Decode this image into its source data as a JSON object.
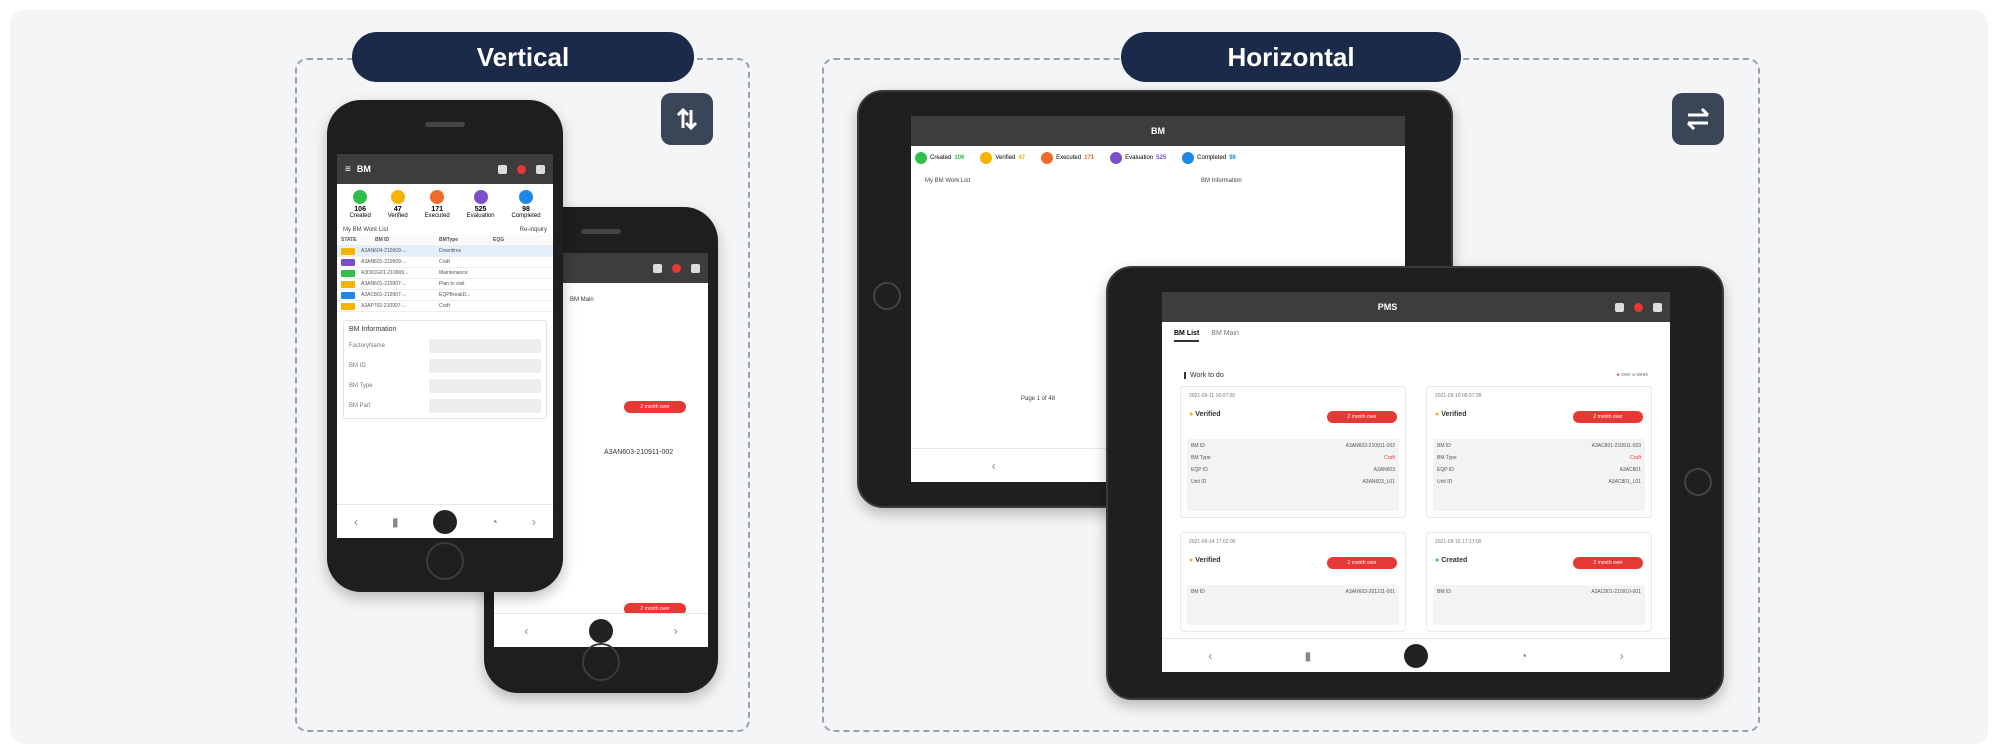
{
  "headings": {
    "vertical": "Vertical",
    "horizontal": "Horizontal"
  },
  "icons": {
    "vertical_toggle": "swap-vertical-icon",
    "horizontal_toggle": "swap-horizontal-icon"
  },
  "colors": {
    "pill_bg": "#1b2a49",
    "created": "#2fbf4a",
    "verified": "#f5b400",
    "executed": "#f06a2b",
    "evaluation": "#7b4fc9",
    "completed": "#1e88e5",
    "alert": "#e53935"
  },
  "phone_front": {
    "app_title": "BM",
    "stats": [
      {
        "value": "106",
        "label": "Created"
      },
      {
        "value": "47",
        "label": "Verified"
      },
      {
        "value": "171",
        "label": "Executed"
      },
      {
        "value": "525",
        "label": "Evaluation"
      },
      {
        "value": "98",
        "label": "Completed"
      }
    ],
    "list_title": "My BM Work List",
    "inquiry": "Re-inquiry",
    "columns": [
      "STATE",
      "BM ID",
      "BMType",
      "EQG"
    ],
    "rows": [
      {
        "id": "A3AN604-210909-...",
        "type": "Downtime"
      },
      {
        "id": "A3AN601-210909-...",
        "type": "Craft"
      },
      {
        "id": "A3D01G01-210909...",
        "type": "Maintenance"
      },
      {
        "id": "A3AN601-210907-...",
        "type": "Plan to visit"
      },
      {
        "id": "A3AC801-210907-...",
        "type": "EQPBreakD..."
      },
      {
        "id": "A3AP702-210907-...",
        "type": "Craft"
      }
    ],
    "info_title": "BM Information",
    "info_labels": [
      "FactoryName",
      "BM ID",
      "BM Type",
      "BM Part"
    ]
  },
  "phone_back": {
    "tab": "BM Main",
    "badge": "2 month over",
    "item_id": "A3AN603-210911-002"
  },
  "tablet_back": {
    "app_title": "BM",
    "stats": [
      {
        "value": "106",
        "label": "Created"
      },
      {
        "value": "47",
        "label": "Verified"
      },
      {
        "value": "171",
        "label": "Executed"
      },
      {
        "value": "525",
        "label": "Evaluation"
      },
      {
        "value": "98",
        "label": "Completed"
      }
    ],
    "list_title": "My BM Work List",
    "info_title": "BM Information",
    "pagination": "Page 1 of 48"
  },
  "tablet_front": {
    "app_title": "PMS",
    "tabs": [
      "BM List",
      "BM Main"
    ],
    "section": "Work to do",
    "legend": "over a week",
    "cards": [
      {
        "date": "2021-09-11 16:07:00",
        "status": "Verified",
        "badge": "2 month over",
        "bm_id": "A3AN603-210911-002",
        "type": "Craft",
        "eqp": "A3AN603",
        "unit": "A3AN603_L01"
      },
      {
        "date": "2021-09-10 09:07:28",
        "status": "Verified",
        "badge": "2 month over",
        "bm_id": "A3AC801-210911-003",
        "type": "Craft",
        "eqp": "A3AC801",
        "unit": "A3AC801_L01"
      },
      {
        "date": "2021-09-14 17:02:00",
        "status": "Verified",
        "badge": "2 month over",
        "bm_id": "A3AN603-201211-001",
        "type": "",
        "eqp": "",
        "unit": ""
      },
      {
        "date": "2021-09-10 17:17:00",
        "status": "Created",
        "badge": "2 month over",
        "bm_id": "A3AC801-210910-001",
        "type": "",
        "eqp": "",
        "unit": ""
      }
    ],
    "field_labels": [
      "BM ID",
      "BM Type",
      "EQP ID",
      "Unit ID"
    ]
  }
}
